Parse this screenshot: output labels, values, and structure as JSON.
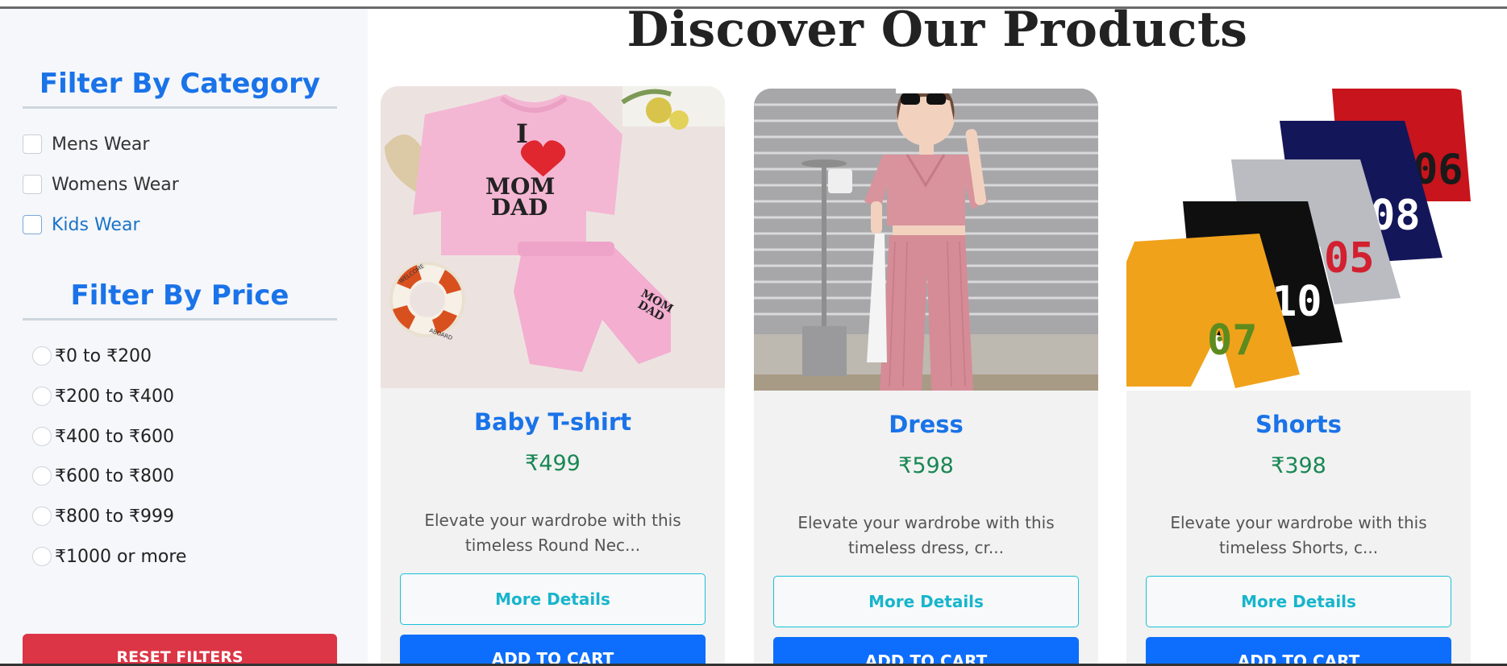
{
  "page": {
    "title": "Discover Our Products"
  },
  "sidebar": {
    "category_title": "Filter By Category",
    "categories": [
      {
        "label": "Mens Wear"
      },
      {
        "label": "Womens Wear"
      },
      {
        "label": "Kids Wear"
      }
    ],
    "price_title": "Filter By Price",
    "prices": [
      {
        "label": "₹0 to ₹200"
      },
      {
        "label": "₹200 to ₹400"
      },
      {
        "label": "₹400 to ₹600"
      },
      {
        "label": "₹600 to ₹800"
      },
      {
        "label": "₹800 to ₹999"
      },
      {
        "label": "₹1000 or more"
      }
    ],
    "reset_label": "RESET FILTERS"
  },
  "products": [
    {
      "name": "Baby T-shirt",
      "price": "₹499",
      "desc": "Elevate your wardrobe with this timeless Round Nec...",
      "details_label": "More Details",
      "cart_label": "ADD TO CART"
    },
    {
      "name": "Dress",
      "price": "₹598",
      "desc": "Elevate your wardrobe with this timeless dress, cr...",
      "details_label": "More Details",
      "cart_label": "ADD TO CART"
    },
    {
      "name": "Shorts",
      "price": "₹398",
      "desc": "Elevate your wardrobe with this timeless Shorts, c...",
      "details_label": "More Details",
      "cart_label": "ADD TO CART"
    }
  ],
  "image_text": {
    "tshirt_line1": "I",
    "tshirt_line2": "MOM",
    "tshirt_line3": "DAD",
    "pants_line1": "MOM",
    "pants_line2": "DAD",
    "ring_text1": "WELCOME",
    "ring_text2": "ABOARD",
    "short_numbers": [
      "07",
      "10",
      "05",
      "08",
      "06"
    ]
  },
  "colors": {
    "accent": "#1a73e8",
    "price": "#198754",
    "reset": "#dc3545",
    "cart": "#0d6efd",
    "details": "#17c1d8"
  }
}
